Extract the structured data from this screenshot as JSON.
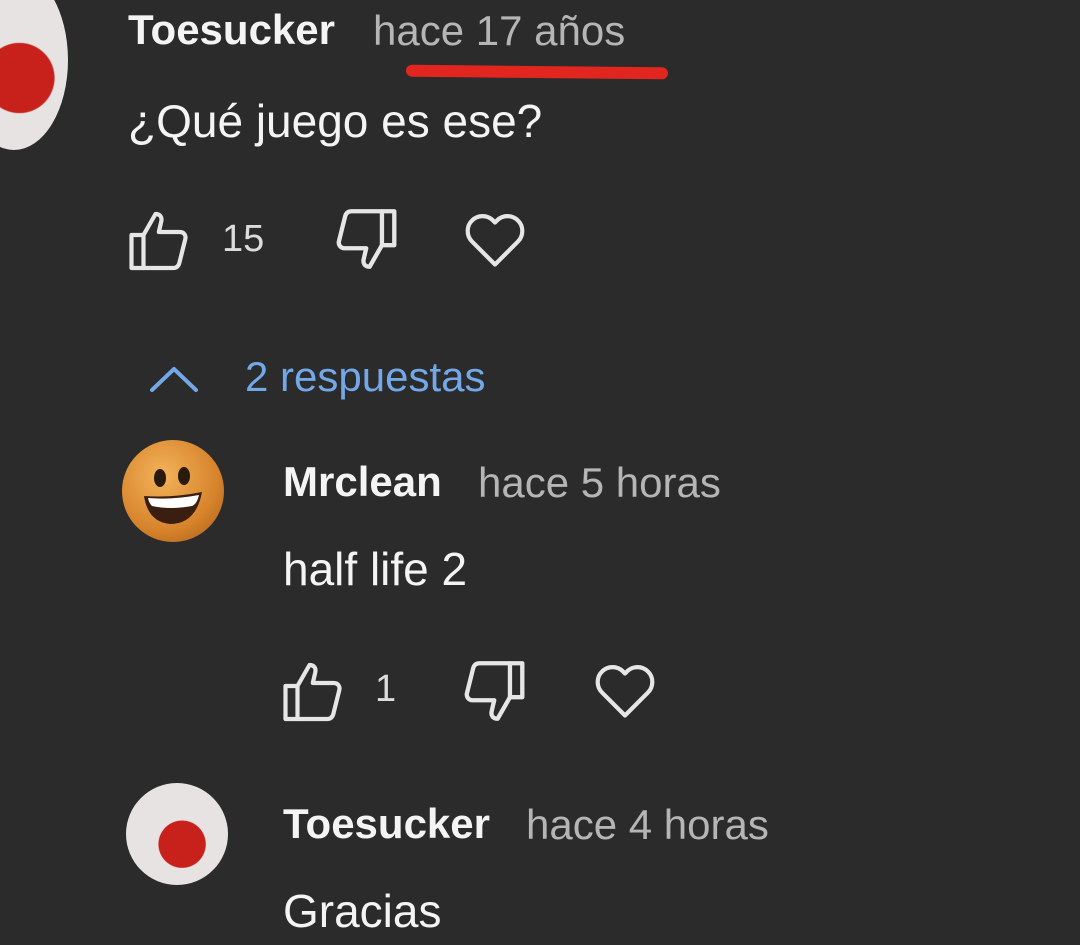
{
  "comments": [
    {
      "username": "Toesucker",
      "time": "hace 17 años",
      "text": "¿Qué juego es ese?",
      "likes": "15"
    },
    {
      "username": "Mrclean",
      "time": "hace 5 horas",
      "text": "half life 2",
      "likes": "1"
    },
    {
      "username": "Toesucker",
      "time": "hace 4 horas",
      "text": "Gracias"
    }
  ],
  "replies_toggle": {
    "label": "2 respuestas",
    "icon": "chevron-up-icon"
  },
  "annotation": {
    "underline_color": "#e0261f"
  },
  "colors": {
    "background": "#2b2b2b",
    "link": "#73a8e8",
    "text": "#f4f4f4",
    "muted": "#b5b5b5"
  }
}
